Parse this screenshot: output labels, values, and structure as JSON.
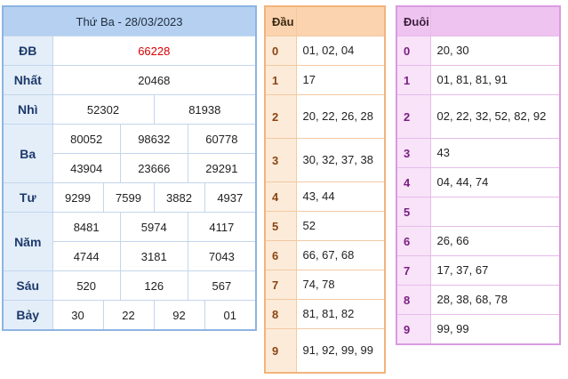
{
  "results": {
    "title": "Thứ Ba - 28/03/2023",
    "db": {
      "label": "ĐB",
      "value": "66228"
    },
    "nhat": {
      "label": "Nhất",
      "value": "20468"
    },
    "nhi": {
      "label": "Nhì",
      "values": [
        "52302",
        "81938"
      ]
    },
    "ba": {
      "label": "Ba",
      "values": [
        "80052",
        "98632",
        "60778",
        "43904",
        "23666",
        "29291"
      ]
    },
    "tu": {
      "label": "Tư",
      "values": [
        "9299",
        "7599",
        "3882",
        "4937"
      ]
    },
    "nam": {
      "label": "Năm",
      "values": [
        "8481",
        "5974",
        "4117",
        "4744",
        "3181",
        "7043"
      ]
    },
    "sau": {
      "label": "Sáu",
      "values": [
        "520",
        "126",
        "567"
      ]
    },
    "bay": {
      "label": "Bảy",
      "values": [
        "30",
        "22",
        "92",
        "01"
      ]
    }
  },
  "dau": {
    "header": "Đầu",
    "rows": [
      {
        "key": "0",
        "value": "01, 02, 04"
      },
      {
        "key": "1",
        "value": "17"
      },
      {
        "key": "2",
        "value": "20, 22, 26, 28"
      },
      {
        "key": "3",
        "value": "30, 32, 37, 38"
      },
      {
        "key": "4",
        "value": "43, 44"
      },
      {
        "key": "5",
        "value": "52"
      },
      {
        "key": "6",
        "value": "66, 67, 68"
      },
      {
        "key": "7",
        "value": "74, 78"
      },
      {
        "key": "8",
        "value": "81, 81, 82"
      },
      {
        "key": "9",
        "value": "91, 92, 99, 99"
      }
    ]
  },
  "duoi": {
    "header": "Đuôi",
    "rows": [
      {
        "key": "0",
        "value": "20, 30"
      },
      {
        "key": "1",
        "value": "01, 81, 81, 91"
      },
      {
        "key": "2",
        "value": "02, 22, 32, 52, 82, 92"
      },
      {
        "key": "3",
        "value": "43"
      },
      {
        "key": "4",
        "value": "04, 44, 74"
      },
      {
        "key": "5",
        "value": ""
      },
      {
        "key": "6",
        "value": "26, 66"
      },
      {
        "key": "7",
        "value": "17, 37, 67"
      },
      {
        "key": "8",
        "value": "28, 38, 68, 78"
      },
      {
        "key": "9",
        "value": "99, 99"
      }
    ]
  },
  "colors": {
    "results_border": "#8db4e2",
    "results_header": "#b5d0f1",
    "special_prize": "#d80000",
    "dau_border": "#f3b37b",
    "dau_header": "#fbd3ae",
    "duoi_border": "#d99be0",
    "duoi_header": "#efc3f0"
  }
}
